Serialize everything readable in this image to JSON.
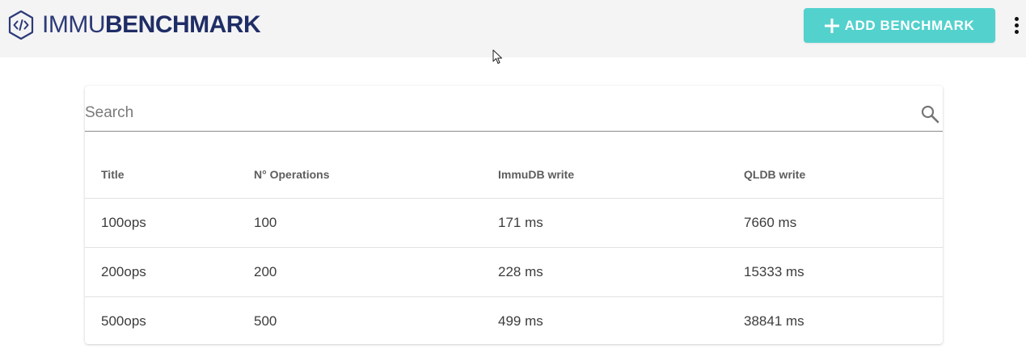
{
  "header": {
    "logo_light": "IMMU",
    "logo_bold": "BENCHMARK",
    "logo_icon": "code-hexagon-icon",
    "add_button_label": "ADD BENCHMARK",
    "add_button_icon": "plus-icon",
    "menu_icon": "more-vertical-icon",
    "colors": {
      "header_bg": "#f4f4f4",
      "brand": "#1f2d66",
      "accent": "#53d1cd"
    }
  },
  "search": {
    "placeholder": "Search",
    "value": ""
  },
  "table": {
    "columns": [
      "Title",
      "N° Operations",
      "ImmuDB write",
      "QLDB write"
    ],
    "rows": [
      [
        "100ops",
        "100",
        "171 ms",
        "7660 ms"
      ],
      [
        "200ops",
        "200",
        "228 ms",
        "15333 ms"
      ],
      [
        "500ops",
        "500",
        "499 ms",
        "38841 ms"
      ]
    ]
  }
}
